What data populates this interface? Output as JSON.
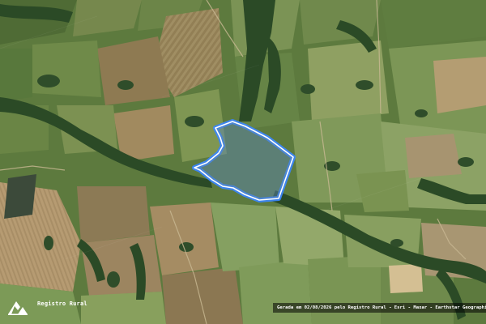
{
  "map": {
    "type": "satellite",
    "overlay_colors": {
      "parcel_outline": "#ffffff",
      "parcel_halo": "#3a86ff",
      "parcel_fill": "#5a86b8"
    }
  },
  "branding": {
    "logo_icon": "registro-rural-logo-icon",
    "logo_label": "Registro Rural"
  },
  "footer": {
    "attribution": "Gerada em 02/08/2026 pelo Registro Rural - Esri - Maxar - Earthstar Geographics"
  }
}
